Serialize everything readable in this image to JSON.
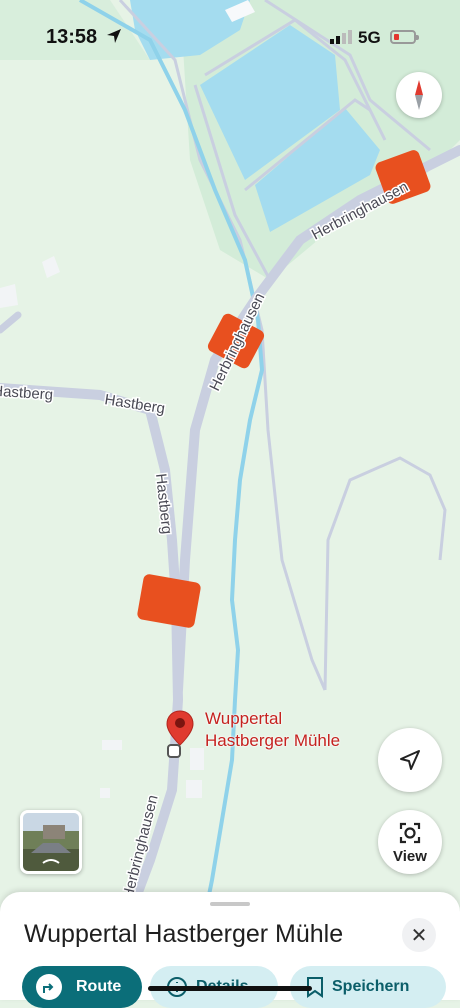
{
  "status_bar": {
    "time": "13:58",
    "network": "5G"
  },
  "map": {
    "street_labels": {
      "herbringhausen_top": "Herbringhausen",
      "herbringhausen_mid": "Herbringhausen",
      "hastberg_west": "Hastberg",
      "hastberg_mid": "Hastberg",
      "hastberg_vertical": "Hastberg",
      "herbringhausen_bottom": "Herbringhausen"
    },
    "place_marker": {
      "line1": "Wuppertal",
      "line2": "Hastberger Mühle"
    },
    "colors": {
      "water": "#a4dcef",
      "road": "#c9cfe0",
      "traffic_heavy": "#e8501f",
      "park": "#e6f3e6",
      "pin": "#e03a2f"
    }
  },
  "controls": {
    "view_label": "View"
  },
  "sheet": {
    "title": "Wuppertal Hastberger Mühle",
    "close_icon": "close-icon",
    "actions": {
      "route": "Route",
      "details": "Details",
      "save": "Speichern"
    }
  }
}
